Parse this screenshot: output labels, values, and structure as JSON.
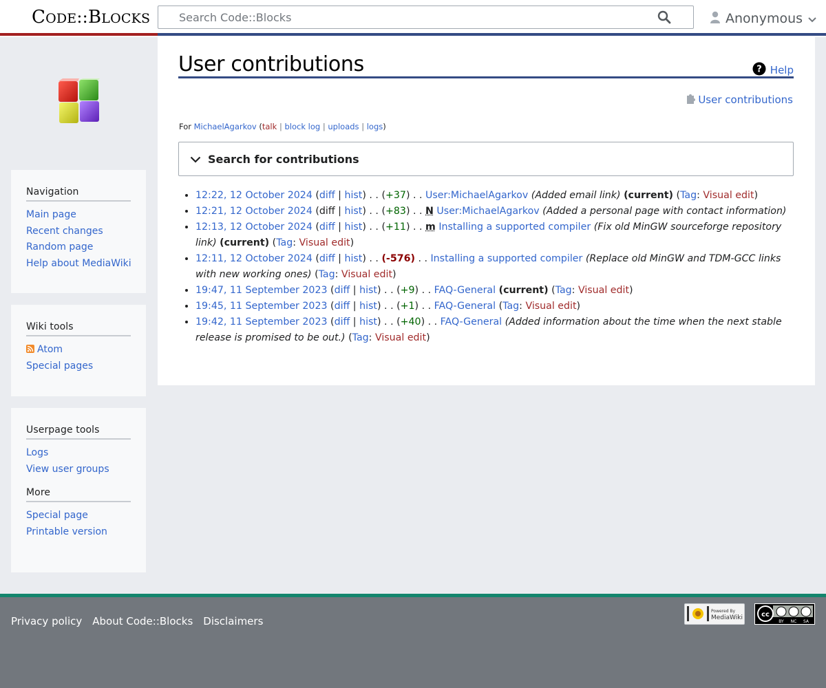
{
  "header": {
    "site_title_parts": [
      "C",
      "ODE",
      "::",
      "B",
      "LOCKS"
    ],
    "search_placeholder": "Search Code::Blocks",
    "user_label": "Anonymous"
  },
  "sidebar": {
    "navigation": {
      "heading": "Navigation",
      "items": [
        "Main page",
        "Recent changes",
        "Random page",
        "Help about MediaWiki"
      ]
    },
    "wiki_tools": {
      "heading": "Wiki tools",
      "items": [
        "Atom",
        "Special pages"
      ]
    },
    "userpage_tools": {
      "heading": "Userpage tools",
      "items": [
        "Logs",
        "View user groups"
      ]
    },
    "more": {
      "heading": "More",
      "items": [
        "Special page",
        "Printable version"
      ]
    }
  },
  "content": {
    "title": "User contributions",
    "help_label": "Help",
    "indicator_label": "User contributions",
    "for_line": {
      "prefix": "For ",
      "user": "MichaelAgarkov",
      "talk": "talk",
      "block_log": "block log",
      "uploads": "uploads",
      "logs": "logs"
    },
    "search_contrib_label": "Search for contributions",
    "entries": [
      {
        "time": "12:22, 12 October 2024",
        "diff_link": true,
        "diff": "+37",
        "flag": "",
        "page": "User:MichaelAgarkov",
        "comment": "(Added email link)",
        "current": true,
        "tag": "Visual edit"
      },
      {
        "time": "12:21, 12 October 2024",
        "diff_link": false,
        "diff": "+83",
        "flag": "N",
        "page": "User:MichaelAgarkov",
        "comment": "(Added a personal page with contact information)",
        "current": false,
        "tag": ""
      },
      {
        "time": "12:13, 12 October 2024",
        "diff_link": true,
        "diff": "+11",
        "flag": "m",
        "page": "Installing a supported compiler",
        "comment": "(Fix old MinGW sourceforge repository link)",
        "current": true,
        "tag": "Visual edit"
      },
      {
        "time": "12:11, 12 October 2024",
        "diff_link": true,
        "diff": "-576",
        "flag": "",
        "page": "Installing a supported compiler",
        "comment": "(Replace old MinGW and TDM-GCC links with new working ones)",
        "current": false,
        "tag": "Visual edit"
      },
      {
        "time": "19:47, 11 September 2023",
        "diff_link": true,
        "diff": "+9",
        "flag": "",
        "page": "FAQ-General",
        "comment": "",
        "current": true,
        "tag": "Visual edit"
      },
      {
        "time": "19:45, 11 September 2023",
        "diff_link": true,
        "diff": "+1",
        "flag": "",
        "page": "FAQ-General",
        "comment": "",
        "current": false,
        "tag": "Visual edit"
      },
      {
        "time": "19:42, 11 September 2023",
        "diff_link": true,
        "diff": "+40",
        "flag": "",
        "page": "FAQ-General",
        "comment": "(Added information about the time when the next stable release is promised to be out.)",
        "current": false,
        "tag": "Visual edit"
      }
    ],
    "labels": {
      "diff": "diff",
      "hist": "hist",
      "current": "(current)",
      "tag": "Tag"
    }
  },
  "footer": {
    "links": [
      "Privacy policy",
      "About Code::Blocks",
      "Disclaimers"
    ],
    "mediawiki_badge": [
      "Powered By",
      "MediaWiki"
    ],
    "cc_badge": [
      "BY",
      "NC",
      "SA"
    ]
  },
  "colors": {
    "link": "#3366cc",
    "link_red": "#a02b2b",
    "accent_red": "#a32020",
    "accent_blue": "#344b84",
    "footer_teal": "#14866d",
    "footer_bg": "#72777d"
  }
}
